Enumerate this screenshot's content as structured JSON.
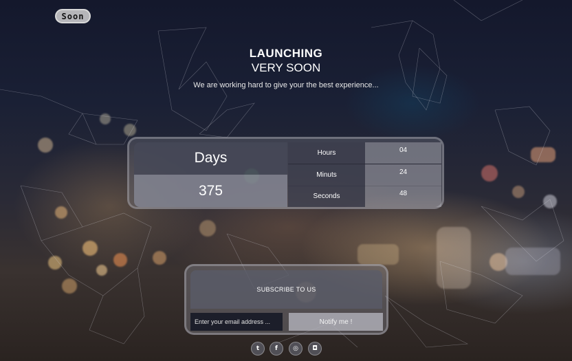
{
  "logo": {
    "text": "Soon"
  },
  "hero": {
    "title_line1": "LAUNCHING",
    "title_line2": "VERY SOON",
    "tagline": "We are working hard to give your the best experience..."
  },
  "countdown": {
    "days_label": "Days",
    "days_value": "375",
    "rows": [
      {
        "label": "Hours",
        "value": "04"
      },
      {
        "label": "Minuts",
        "value": "24"
      },
      {
        "label": "Seconds",
        "value": "48"
      }
    ]
  },
  "subscribe": {
    "heading": "SUBSCRIBE TO US",
    "email_placeholder": "Enter your email address ...",
    "button_label": "Notify me !"
  },
  "social": [
    {
      "icon": "twitter-icon",
      "glyph": "t"
    },
    {
      "icon": "facebook-icon",
      "glyph": "f"
    },
    {
      "icon": "dribbble-icon",
      "glyph": "◎"
    },
    {
      "icon": "instagram-icon",
      "glyph": "◘"
    }
  ]
}
